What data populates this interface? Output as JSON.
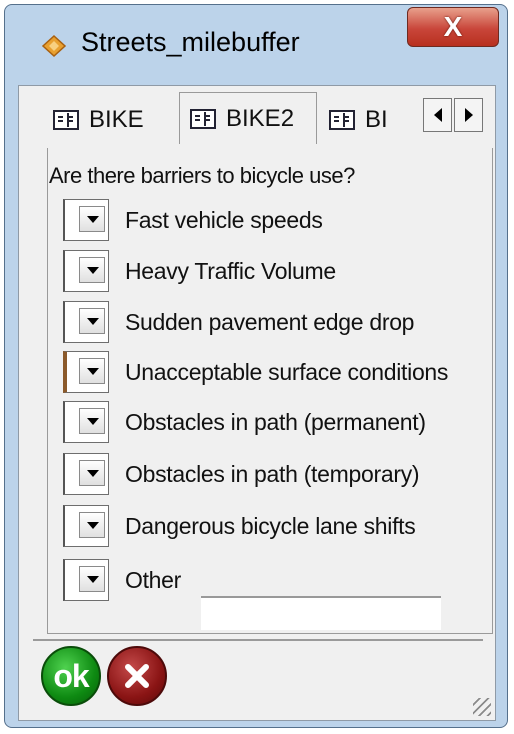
{
  "window": {
    "title": "Streets_milebuffer",
    "close_label": "X"
  },
  "tabs": [
    {
      "label": "BIKE",
      "active": false
    },
    {
      "label": "BIKE2",
      "active": true
    },
    {
      "label": "BI",
      "active": false
    }
  ],
  "form": {
    "question": "Are there barriers to bicycle use?",
    "items": [
      {
        "label": "Fast vehicle speeds"
      },
      {
        "label": "Heavy Traffic Volume"
      },
      {
        "label": "Sudden pavement edge drop"
      },
      {
        "label": "Unacceptable surface conditions"
      },
      {
        "label": "Obstacles in path (permanent)"
      },
      {
        "label": "Obstacles in path (temporary)"
      },
      {
        "label": "Dangerous bicycle lane shifts"
      },
      {
        "label": "Other"
      }
    ],
    "other_value": ""
  },
  "buttons": {
    "ok_label": "ok"
  },
  "colors": {
    "ok": "#0e8a12",
    "cancel": "#8a1414",
    "frame": "#bcd3ea"
  }
}
